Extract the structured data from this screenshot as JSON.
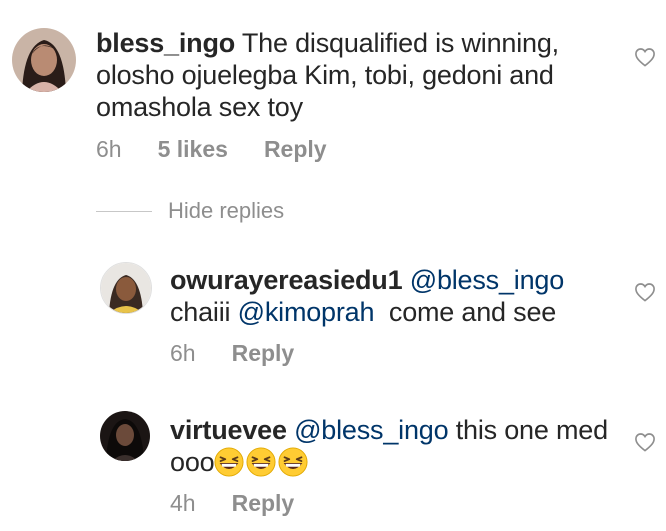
{
  "comments": [
    {
      "username": "bless_ingo",
      "text": " The disqualified is winning, olosho ojuelegba Kim, tobi, gedoni and omashola sex toy",
      "time": "6h",
      "likes": "5 likes",
      "reply_label": "Reply"
    }
  ],
  "hide_replies_label": "Hide replies",
  "replies": [
    {
      "username": "owurayereasiedu1",
      "mention1": "@bless_ingo",
      "line2_prefix": "chaiii ",
      "mention2": "@kimoprah",
      "line2_suffix": "  come and see",
      "time": "6h",
      "reply_label": "Reply"
    },
    {
      "username": "virtuevee",
      "mention1": "@bless_ingo",
      "text_after": " this one med",
      "line2": "ooo",
      "emoji_count": 3,
      "emoji_name": "grinning-squinting-face",
      "time": "4h",
      "reply_label": "Reply"
    }
  ],
  "colors": {
    "text": "#262626",
    "mention": "#003569",
    "meta": "#8e8e8e",
    "divider": "#c7c7c7"
  },
  "icons": {
    "like": "heart-outline-icon"
  }
}
